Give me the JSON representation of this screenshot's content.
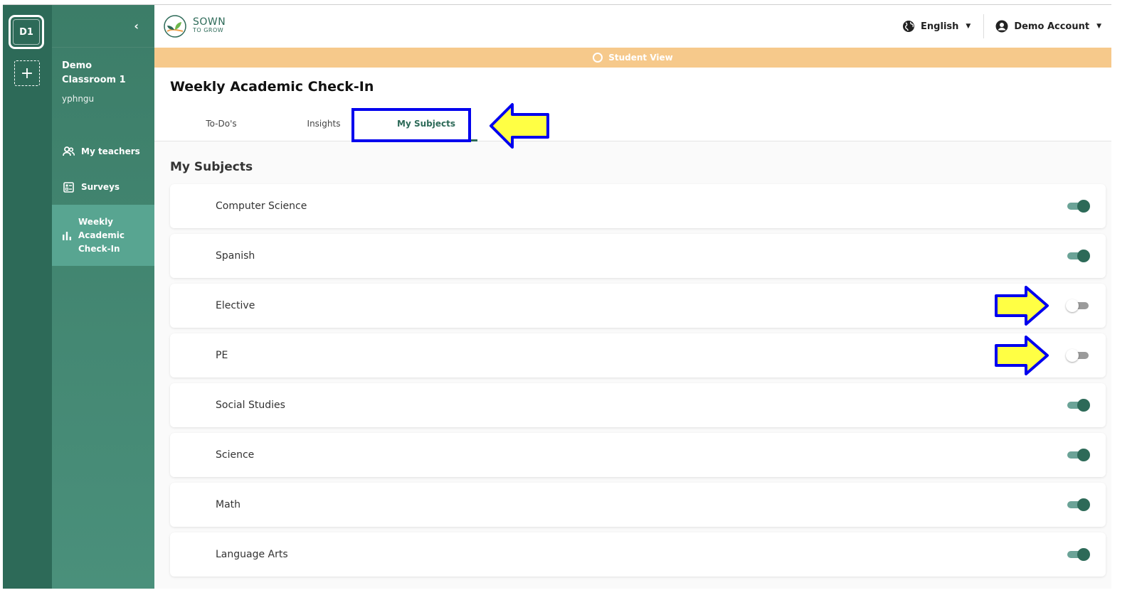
{
  "rail": {
    "badge": "D1",
    "add_label": "+"
  },
  "sidebar": {
    "collapse_label": "‹",
    "class_name": "Demo Classroom 1",
    "username": "yphngu",
    "items": [
      {
        "label": "My teachers",
        "icon": "people-icon"
      },
      {
        "label": "Surveys",
        "icon": "survey-icon"
      },
      {
        "label": "Weekly Academic Check-In",
        "icon": "bar-chart-icon",
        "active": true
      }
    ]
  },
  "topbar": {
    "logo_big": "SOWN",
    "logo_small": "TO GROW",
    "language": "English",
    "account": "Demo Account"
  },
  "banner": {
    "label": "Student View"
  },
  "page": {
    "title": "Weekly Academic Check-In",
    "tabs": [
      {
        "label": "To-Do's",
        "active": false
      },
      {
        "label": "Insights",
        "active": false
      },
      {
        "label": "My Subjects",
        "active": true
      }
    ],
    "section_title": "My Subjects"
  },
  "subjects": [
    {
      "label": "Computer Science",
      "enabled": true
    },
    {
      "label": "Spanish",
      "enabled": true
    },
    {
      "label": "Elective",
      "enabled": false
    },
    {
      "label": "PE",
      "enabled": false
    },
    {
      "label": "Social Studies",
      "enabled": true
    },
    {
      "label": "Science",
      "enabled": true
    },
    {
      "label": "Math",
      "enabled": true
    },
    {
      "label": "Language Arts",
      "enabled": true
    }
  ],
  "colors": {
    "brand": "#2d6a58",
    "sidebar": "#4a907b",
    "banner": "#f6c98b",
    "annotation_outline": "#0000ee",
    "annotation_fill": "#ffff44"
  }
}
